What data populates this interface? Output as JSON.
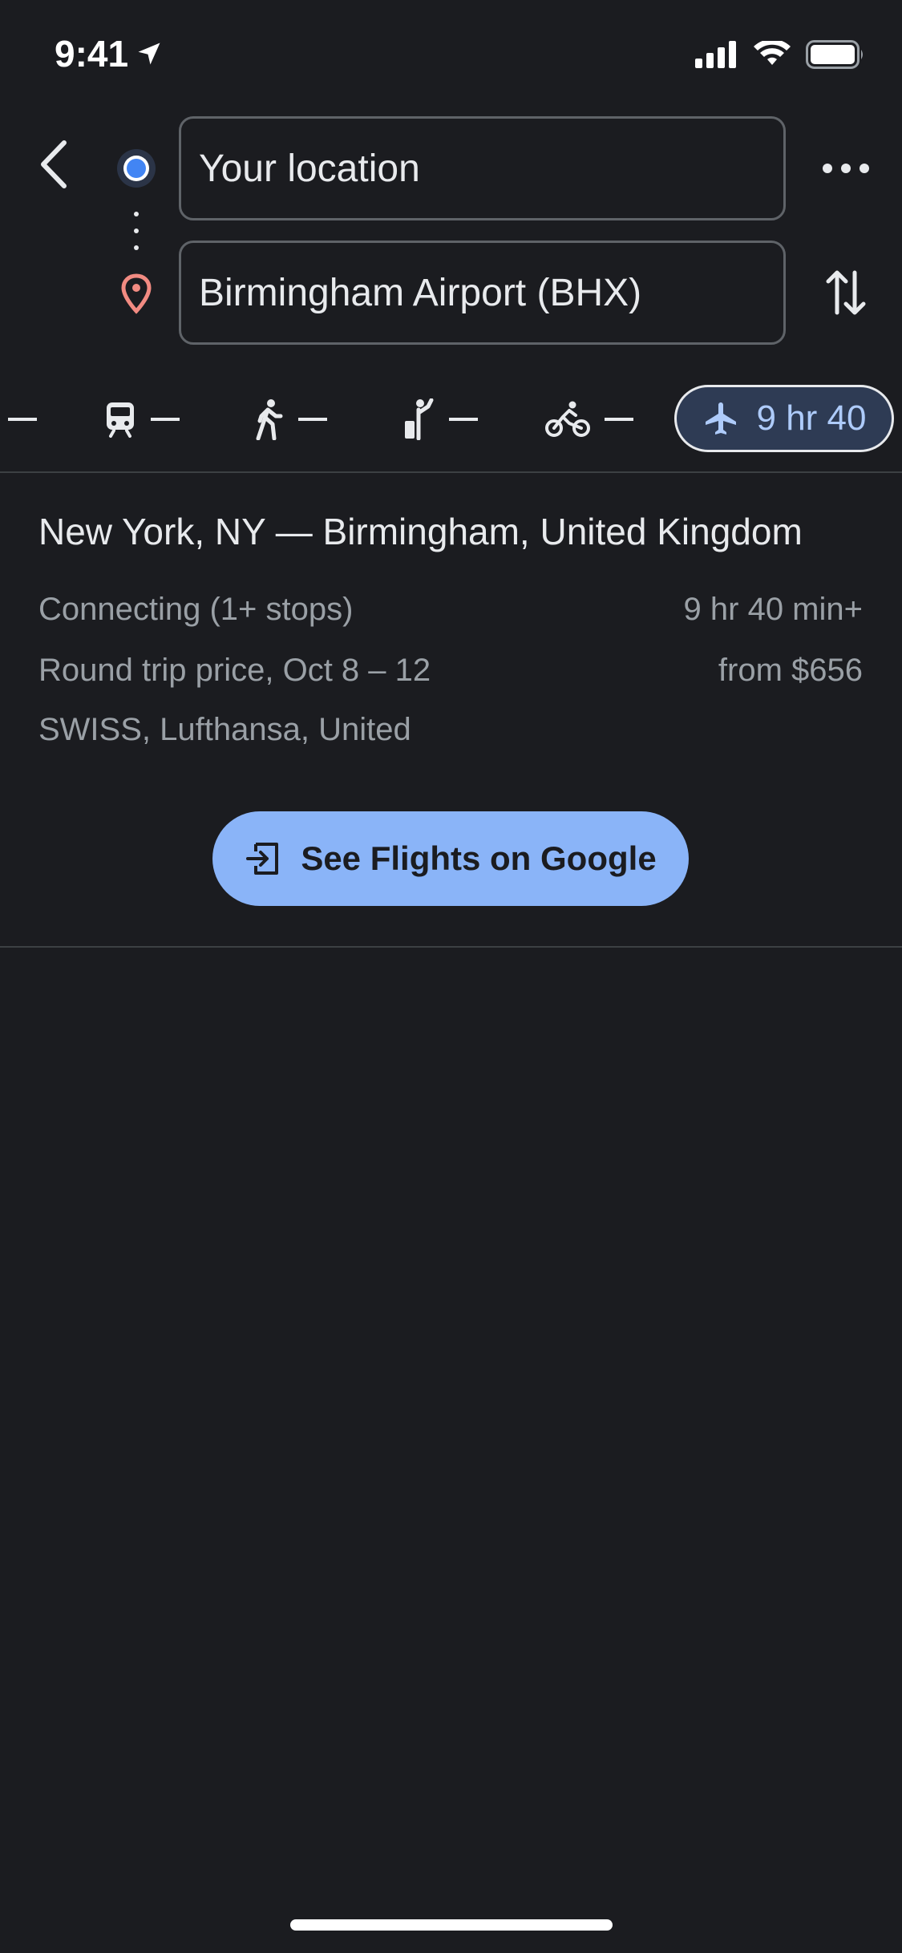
{
  "status_bar": {
    "time": "9:41"
  },
  "directions": {
    "origin_value": "Your location",
    "destination_value": "Birmingham Airport (BHX)"
  },
  "modes": [
    {
      "name": "drive",
      "value": "—"
    },
    {
      "name": "transit",
      "value": "—"
    },
    {
      "name": "walk",
      "value": "—"
    },
    {
      "name": "ride-hail",
      "value": "—"
    },
    {
      "name": "bike",
      "value": "—"
    },
    {
      "name": "flight",
      "value": "9 hr 40",
      "selected": true
    }
  ],
  "result": {
    "route_title": "New York, NY — Birmingham, United Kingdom",
    "connection": "Connecting (1+ stops)",
    "duration": "9 hr 40 min+",
    "price_label": "Round trip price, Oct 8 – 12",
    "price": "from $656",
    "airlines": "SWISS, Lufthansa, United"
  },
  "cta": {
    "label": "See Flights on Google"
  },
  "colors": {
    "background": "#1b1c20",
    "accent": "#8ab4f8",
    "origin_dot": "#4285f4",
    "destination_pin": "#f28b82"
  }
}
